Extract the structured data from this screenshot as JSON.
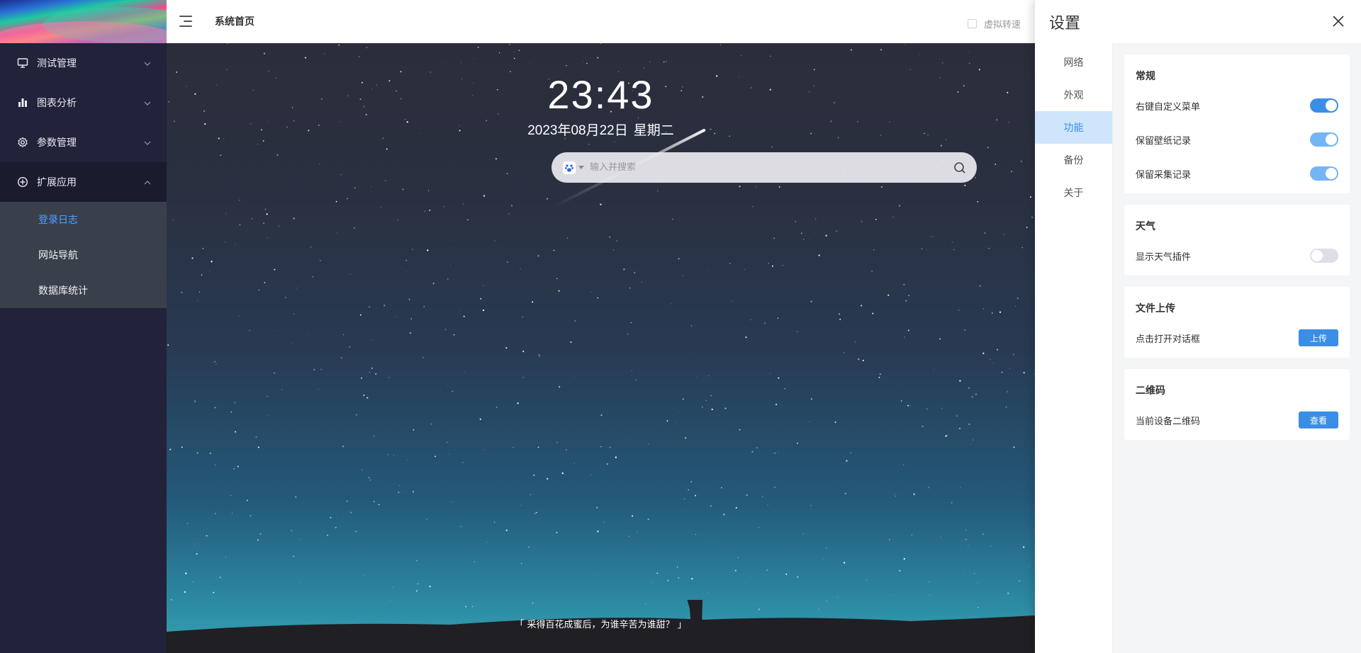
{
  "sidebar": {
    "items": [
      {
        "label": "测试管理",
        "icon": "monitor-icon"
      },
      {
        "label": "图表分析",
        "icon": "bar-chart-icon"
      },
      {
        "label": "参数管理",
        "icon": "gear-icon"
      },
      {
        "label": "扩展应用",
        "icon": "plus-circle-icon"
      }
    ],
    "subitems": [
      {
        "label": "登录日志"
      },
      {
        "label": "网站导航"
      },
      {
        "label": "数据库统计"
      }
    ]
  },
  "header": {
    "title": "系统首页",
    "virtual_speed_label": "虚拟转速",
    "virtual_speed_checked": false
  },
  "main": {
    "time": "23:43",
    "date": "2023年08月22日",
    "weekday": "星期二",
    "search_placeholder": "输入并搜索",
    "search_engine_icon": "baidu-paw-icon",
    "quote": "「 采得百花成蜜后，为谁辛苦为谁甜？ 」"
  },
  "settings": {
    "title": "设置",
    "nav": [
      {
        "label": "网络"
      },
      {
        "label": "外观"
      },
      {
        "label": "功能"
      },
      {
        "label": "备份"
      },
      {
        "label": "关于"
      }
    ],
    "active_nav": "功能",
    "sections": {
      "general": {
        "title": "常规",
        "rows": [
          {
            "label": "右键自定义菜单",
            "on": true
          },
          {
            "label": "保留壁纸记录",
            "on": true
          },
          {
            "label": "保留采集记录",
            "on": true
          }
        ]
      },
      "weather": {
        "title": "天气",
        "rows": [
          {
            "label": "显示天气插件",
            "on": false
          }
        ]
      },
      "upload": {
        "title": "文件上传",
        "row_label": "点击打开对话框",
        "button": "上传"
      },
      "qrcode": {
        "title": "二维码",
        "row_label": "当前设备二维码",
        "button": "查看"
      }
    }
  },
  "colors": {
    "sidebar_bg": "#22223a",
    "submenu_bg": "#3a3f4c",
    "accent": "#3a8ee6",
    "active_link": "#4aa3ff"
  }
}
